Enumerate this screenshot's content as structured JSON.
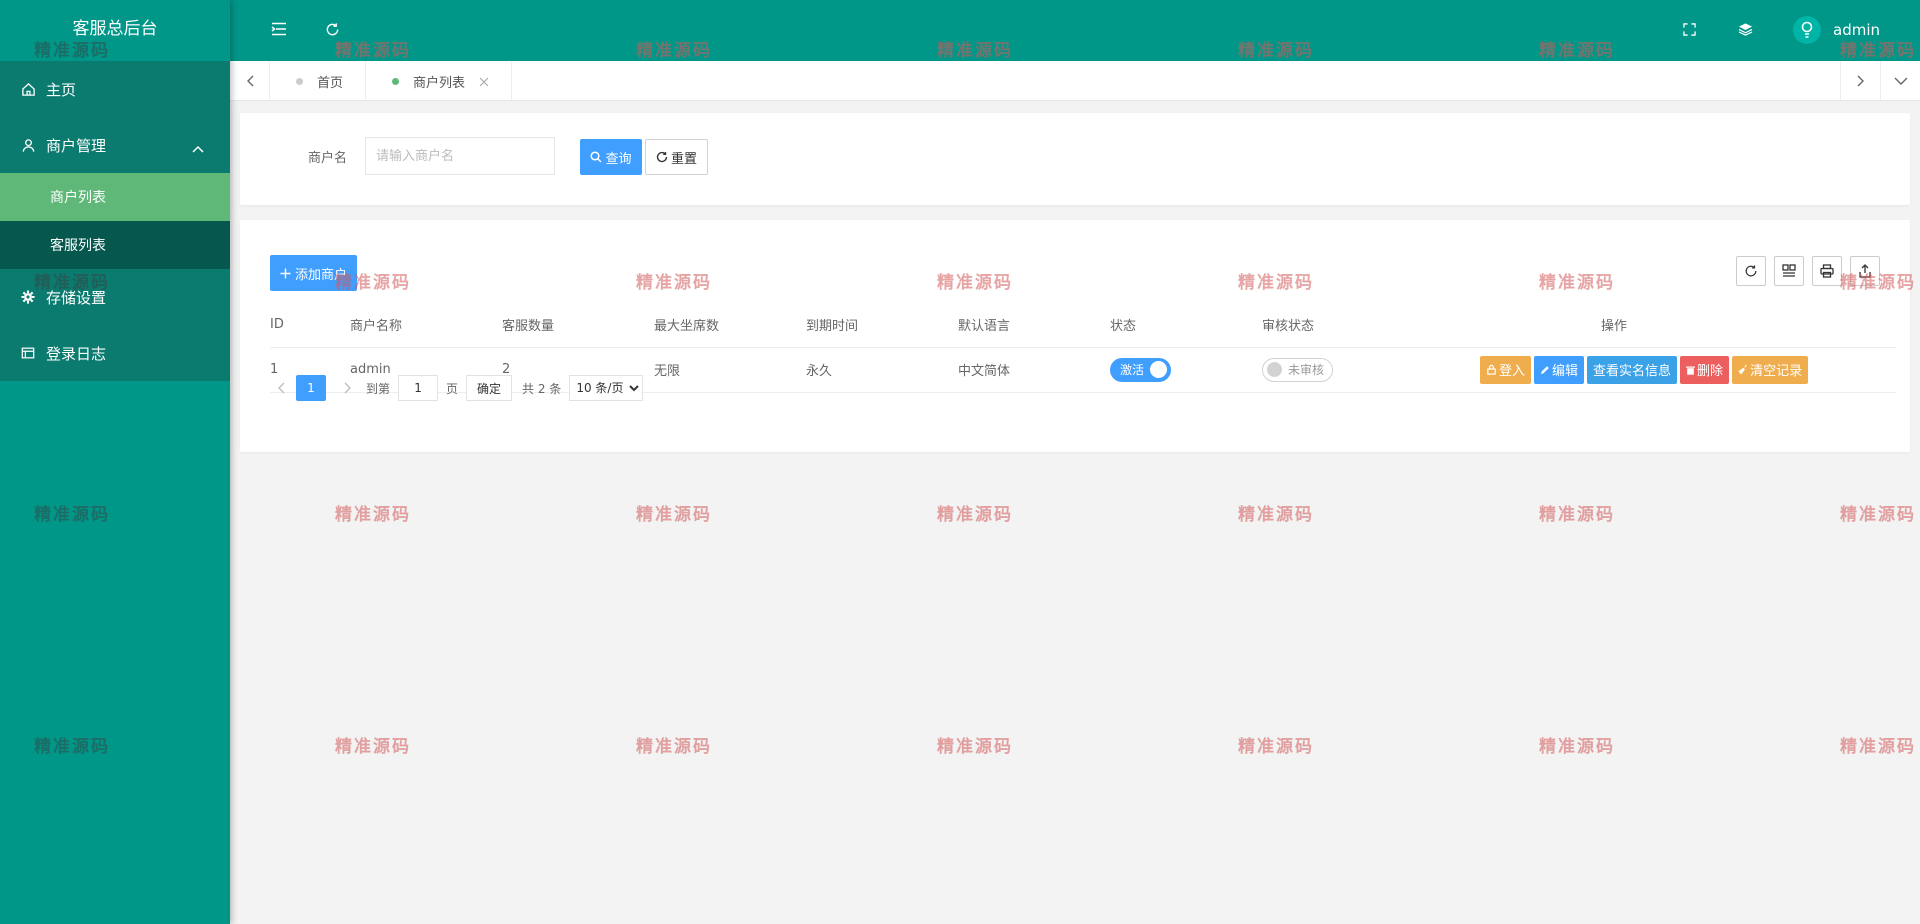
{
  "app": {
    "title": "客服总后台"
  },
  "sidebar": {
    "items": [
      {
        "label": "主页",
        "icon": "home-icon"
      },
      {
        "label": "商户管理",
        "icon": "user-icon",
        "expanded": true,
        "children": [
          {
            "label": "商户列表",
            "active": true
          },
          {
            "label": "客服列表",
            "active": false
          }
        ]
      },
      {
        "label": "存储设置",
        "icon": "gear-icon"
      },
      {
        "label": "登录日志",
        "icon": "log-icon"
      }
    ]
  },
  "header": {
    "user": "admin"
  },
  "tabs": [
    {
      "label": "首页",
      "active": false
    },
    {
      "label": "商户列表",
      "active": true
    }
  ],
  "search": {
    "label": "商户名",
    "placeholder": "请输入商户名",
    "query_label": "查询",
    "reset_label": "重置"
  },
  "toolbar": {
    "add_label": "添加商户"
  },
  "table": {
    "columns": [
      "ID",
      "商户名称",
      "客服数量",
      "最大坐席数",
      "到期时间",
      "默认语言",
      "状态",
      "审核状态",
      "操作"
    ],
    "rows": [
      {
        "id": "1",
        "name": "admin",
        "cs_count": "2",
        "max_seats": "无限",
        "expire": "永久",
        "language": "中文简体",
        "status": "激活",
        "audit": "未审核"
      }
    ],
    "actions": [
      "登入",
      "编辑",
      "查看实名信息",
      "删除",
      "清空记录"
    ]
  },
  "pagination": {
    "current": "1",
    "goto_label": "到第",
    "goto_value": "1",
    "page_label": "页",
    "confirm_label": "确定",
    "total_label": "共 2 条",
    "page_size": "10 条/页"
  },
  "watermark": {
    "text": "精准源码"
  },
  "colors": {
    "primary": "#009688",
    "sidebar_dark": "#0b7b70",
    "active": "#5fb878",
    "blue": "#409eff",
    "orange": "#f0ad4e",
    "red": "#ed5f5f"
  }
}
